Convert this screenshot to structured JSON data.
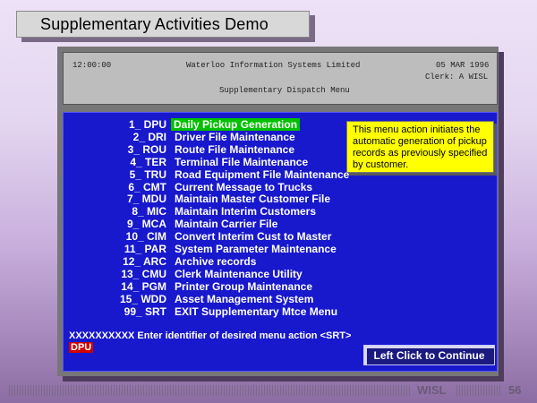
{
  "slide": {
    "title": "Supplementary Activities Demo",
    "footer_brand": "WISL",
    "page_number": "56"
  },
  "terminal_header": {
    "time": "12:00:00",
    "company": "Waterloo Information Systems Limited",
    "date": "05 MAR 1996",
    "clerk": "Clerk: A WISL",
    "screen_title": "Supplementary Dispatch Menu"
  },
  "menu": {
    "items": [
      {
        "code": "1_ DPU",
        "label": "Daily Pickup Generation",
        "selected": true
      },
      {
        "code": "2_ DRI",
        "label": "Driver File Maintenance"
      },
      {
        "code": "3_ ROU",
        "label": "Route File Maintenance"
      },
      {
        "code": "4_ TER",
        "label": "Terminal File Maintenance"
      },
      {
        "code": "5_ TRU",
        "label": "Road Equipment File Maintenance"
      },
      {
        "code": "6_ CMT",
        "label": "Current Message to Trucks"
      },
      {
        "code": "7_ MDU",
        "label": "Maintain Master Customer File"
      },
      {
        "code": "8_ MIC",
        "label": "Maintain Interim Customers"
      },
      {
        "code": "9_ MCA",
        "label": "Maintain Carrier File"
      },
      {
        "code": "10_ CIM",
        "label": "Convert Interim Cust to Master"
      },
      {
        "code": "11_ PAR",
        "label": "System Parameter Maintenance"
      },
      {
        "code": "12_ ARC",
        "label": "Archive records"
      },
      {
        "code": "13_ CMU",
        "label": "Clerk Maintenance Utility"
      },
      {
        "code": "14_ PGM",
        "label": "Printer Group Maintenance"
      },
      {
        "code": "15_ WDD",
        "label": "Asset Management System"
      },
      {
        "code": "99_ SRT",
        "label": "EXIT Supplementary Mtce Menu"
      }
    ],
    "prompt": "XXXXXXXXXX Enter identifier of desired menu action <SRT>",
    "entry_value": "DPU"
  },
  "tooltip": {
    "text": "This menu action initiates the automatic generation of pickup records as previously specified by customer."
  },
  "continue_button": {
    "label": "Left Click to Continue"
  },
  "colors": {
    "terminal_bg": "#1818cc",
    "selected_bg": "#00c000",
    "tooltip_bg": "#ffff00",
    "entry_bg": "#d00000"
  }
}
